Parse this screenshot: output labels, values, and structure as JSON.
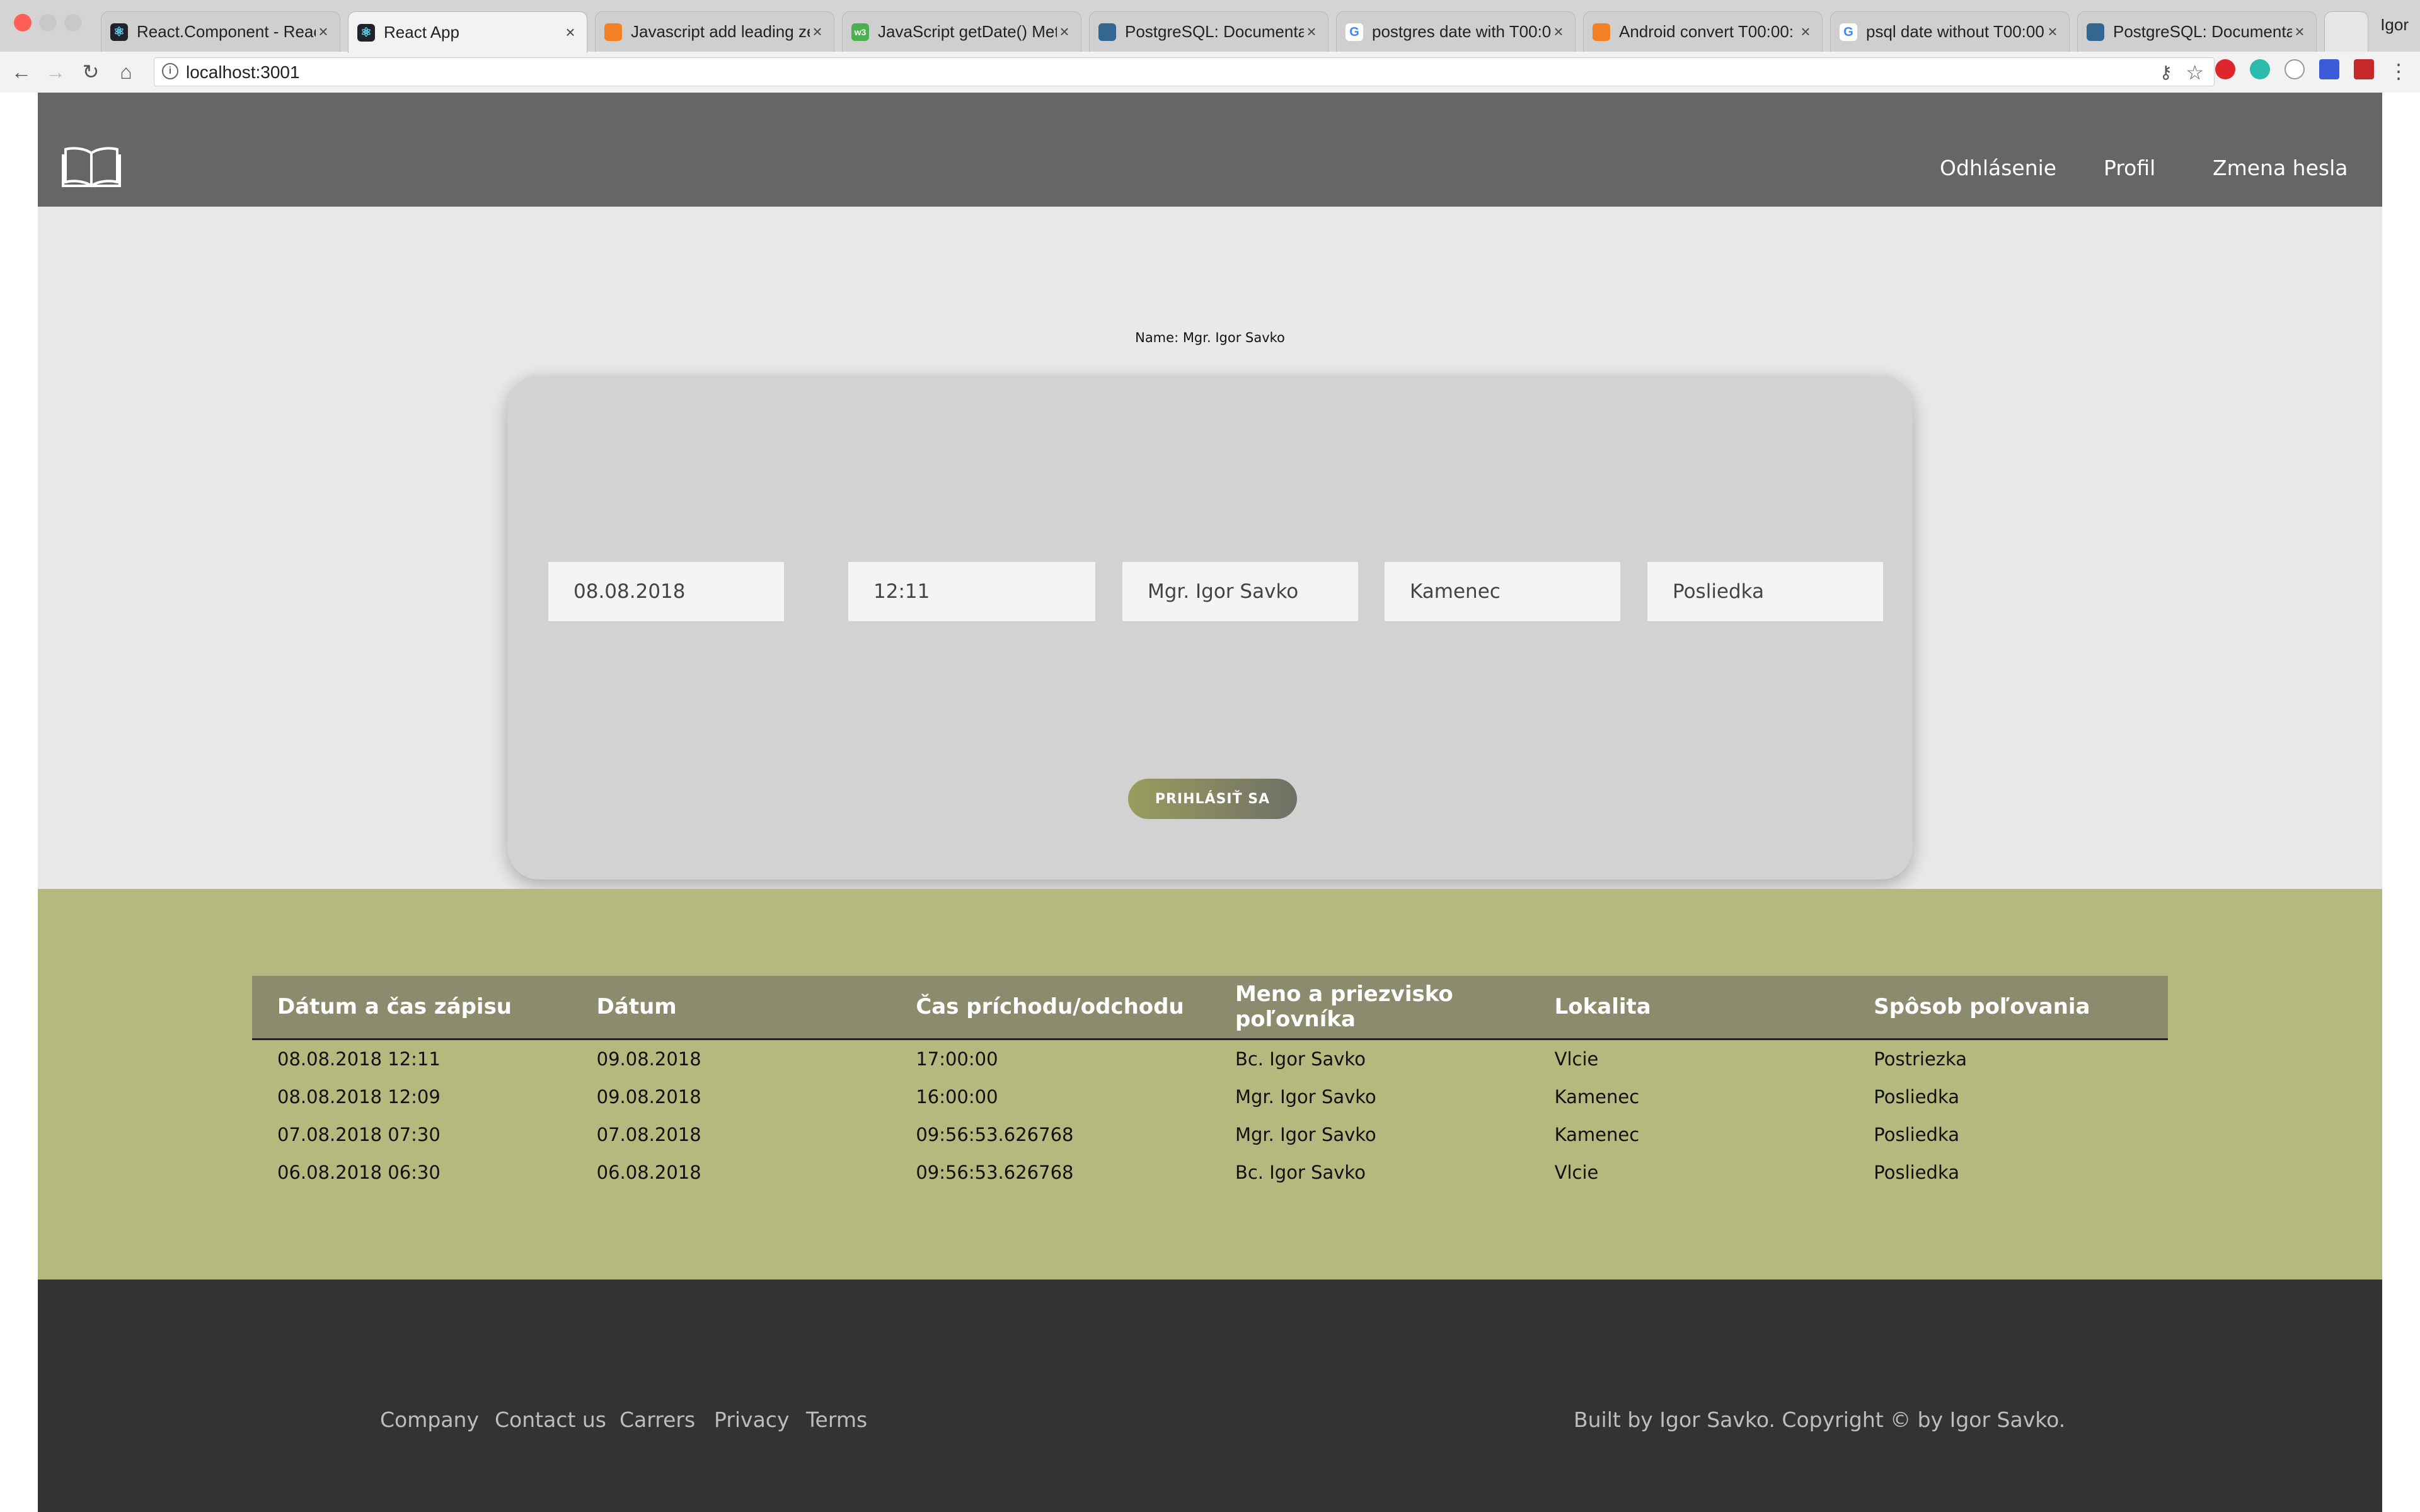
{
  "browser": {
    "tabs": [
      {
        "label": "React.Component - Reac",
        "icon": "react-icon"
      },
      {
        "label": "React App",
        "icon": "react-icon",
        "active": true
      },
      {
        "label": "Javascript add leading ze",
        "icon": "stackoverflow-icon"
      },
      {
        "label": "JavaScript getDate() Met",
        "icon": "w3schools-icon"
      },
      {
        "label": "PostgreSQL: Documenta",
        "icon": "postgresql-icon"
      },
      {
        "label": "postgres date with T00:0",
        "icon": "google-icon"
      },
      {
        "label": "Android convert T00:00:",
        "icon": "stackoverflow-icon"
      },
      {
        "label": "psql date without T00:00",
        "icon": "google-icon"
      },
      {
        "label": "PostgreSQL: Documenta",
        "icon": "postgresql-icon"
      }
    ],
    "profile_name": "Igor",
    "url": "localhost:3001"
  },
  "header": {
    "nav": [
      {
        "label": "Odhlásenie"
      },
      {
        "label": "Profil"
      },
      {
        "label": "Zmena hesla"
      }
    ]
  },
  "hero": {
    "name_line": "Name: Mgr. Igor Savko",
    "fields": [
      {
        "name": "date",
        "value": "08.08.2018"
      },
      {
        "name": "time",
        "value": "12:11"
      },
      {
        "name": "hunter",
        "value": "Mgr. Igor Savko"
      },
      {
        "name": "locality",
        "value": "Kamenec"
      },
      {
        "name": "method",
        "value": "Posliedka"
      }
    ],
    "submit_label": "PRIHLÁSIŤ SA"
  },
  "table": {
    "headers": [
      "Dátum a čas zápisu",
      "Dátum",
      "Čas príchodu/odchodu",
      "Meno a priezvisko poľovníka",
      "Lokalita",
      "Spôsob poľovania"
    ],
    "rows": [
      [
        "08.08.2018 12:11",
        "09.08.2018",
        "17:00:00",
        "Bc. Igor Savko",
        "Vlcie",
        "Postriezka"
      ],
      [
        "08.08.2018 12:09",
        "09.08.2018",
        "16:00:00",
        "Mgr. Igor Savko",
        "Kamenec",
        "Posliedka"
      ],
      [
        "07.08.2018 07:30",
        "07.08.2018",
        "09:56:53.626768",
        "Mgr. Igor Savko",
        "Kamenec",
        "Posliedka"
      ],
      [
        "06.08.2018 06:30",
        "06.08.2018",
        "09:56:53.626768",
        "Bc. Igor Savko",
        "Vlcie",
        "Posliedka"
      ]
    ]
  },
  "footer": {
    "links": [
      "Company",
      "Contact us",
      "Carrers",
      "Privacy",
      "Terms"
    ],
    "copyright": "Built by Igor Savko. Copyright © by Igor Savko."
  },
  "colors": {
    "header_bg": "#666666",
    "hero_bg": "#e9e9e9",
    "card_bg": "#d2d2d2",
    "table_section_bg": "#b4b97e",
    "table_header_bg": "#8b8c6e",
    "footer_bg": "#333333"
  }
}
